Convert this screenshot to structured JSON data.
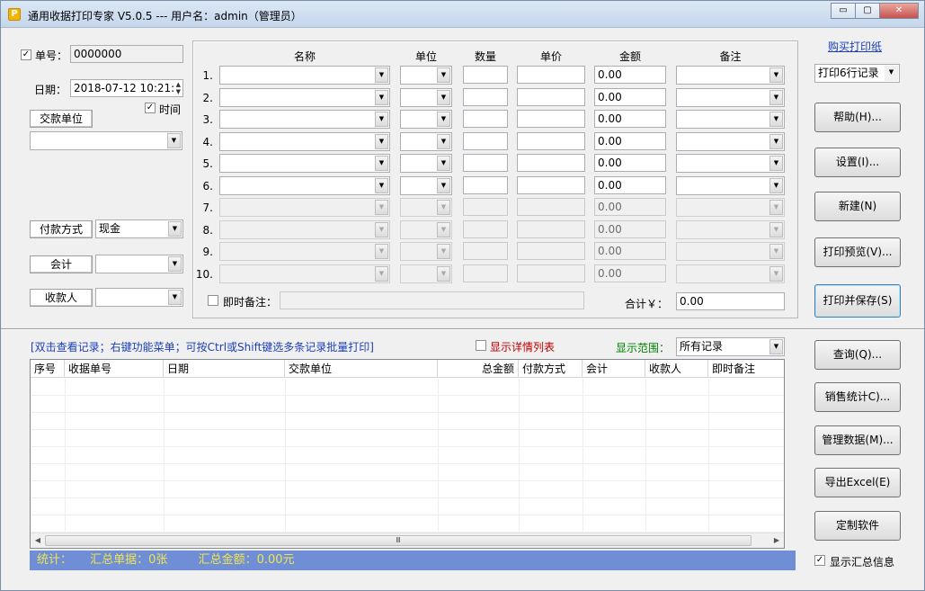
{
  "window": {
    "title": "通用收据打印专家 V5.0.5 --- 用户名：admin（管理员）",
    "minimize": "▭",
    "maximize": "▢",
    "close": "✕"
  },
  "left": {
    "number_label": "单号：",
    "number_value": "0000000",
    "date_label": "日期：",
    "date_value": "2018-07-12 10:21:",
    "time_label": "时间",
    "payer_button": "交款单位",
    "payer_value": "",
    "payment_button": "付款方式",
    "payment_value": "现金",
    "accountant_button": "会计",
    "accountant_value": "",
    "cashier_button": "收款人",
    "cashier_value": ""
  },
  "grid": {
    "headers": [
      "名称",
      "单位",
      "数量",
      "单价",
      "金额",
      "备注"
    ],
    "rows": [
      {
        "no": "1.",
        "amount": "0.00",
        "enabled": true
      },
      {
        "no": "2.",
        "amount": "0.00",
        "enabled": true
      },
      {
        "no": "3.",
        "amount": "0.00",
        "enabled": true
      },
      {
        "no": "4.",
        "amount": "0.00",
        "enabled": true
      },
      {
        "no": "5.",
        "amount": "0.00",
        "enabled": true
      },
      {
        "no": "6.",
        "amount": "0.00",
        "enabled": true
      },
      {
        "no": "7.",
        "amount": "0.00",
        "enabled": false
      },
      {
        "no": "8.",
        "amount": "0.00",
        "enabled": false
      },
      {
        "no": "9.",
        "amount": "0.00",
        "enabled": false
      },
      {
        "no": "10.",
        "amount": "0.00",
        "enabled": false
      }
    ],
    "instant_note_label": "即时备注：",
    "total_label": "合计￥：",
    "total_value": "0.00"
  },
  "right": {
    "buy_link": "购买打印纸",
    "print_rows_value": "打印6行记录",
    "help": "帮助(H)...",
    "settings": "设置(I)...",
    "new": "新建(N)",
    "preview": "打印预览(V)...",
    "print_save": "打印并保存(S)",
    "query": "查询(Q)...",
    "sales_stats": "销售统计C)...",
    "manage_data": "管理数据(M)...",
    "export_excel": "导出Excel(E)",
    "custom_software": "定制软件",
    "show_summary": "显示汇总信息"
  },
  "records": {
    "hint": "[双击查看记录；右键功能菜单；可按Ctrl或Shift键选多条记录批量打印]",
    "show_detail": "显示详情列表",
    "range_label": "显示范围：",
    "range_value": "所有记录",
    "columns": [
      "序号",
      "收据单号",
      "日期",
      "交款单位",
      "总金额",
      "付款方式",
      "会计",
      "收款人",
      "即时备注"
    ],
    "scroll_grip": "Ⅲ"
  },
  "status": {
    "label": "统计：",
    "count_label": "汇总单据：",
    "count_value": "0张",
    "amount_label": "汇总金额：",
    "amount_value": "0.00元"
  },
  "colors": {
    "hint_text": "#1b3fb8",
    "detail_text": "#c00000",
    "range_text": "#008000",
    "status_bg": "#6f8ed6",
    "status_text": "#f0e64a"
  }
}
